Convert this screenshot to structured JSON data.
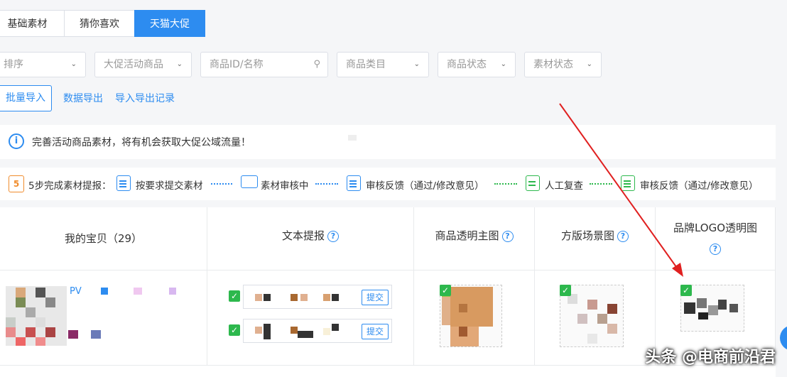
{
  "tabs": [
    "基础素材",
    "猜你喜欢",
    "天猫大促"
  ],
  "filters": {
    "sort": "排序",
    "activity": "大促活动商品",
    "search_placeholder": "商品ID/名称",
    "category": "商品类目",
    "status": "商品状态",
    "material_status": "素材状态"
  },
  "actions": {
    "batch_import": "批量导入",
    "data_export": "数据导出",
    "import_export_log": "导入导出记录"
  },
  "notice": "完善活动商品素材，将有机会获取大促公域流量！",
  "steps": {
    "intro": "5步完成素材提报：",
    "items": [
      "按要求提交素材",
      "素材审核中",
      "审核反馈（通过/修改意见）",
      "人工复查",
      "审核反馈（通过/修改意见）"
    ],
    "calendar_num": "5"
  },
  "table": {
    "headers": [
      "我的宝贝（29）",
      "文本提报",
      "商品透明主图",
      "方版场景图",
      "品牌LOGO透明图"
    ],
    "row": {
      "product_prefix": "PV",
      "submit_label": "提交"
    }
  },
  "watermark": "头条 @电商前沿君",
  "colors": {
    "primary": "#2d8cf0",
    "success": "#2db84d",
    "arrow": "#e02020"
  }
}
